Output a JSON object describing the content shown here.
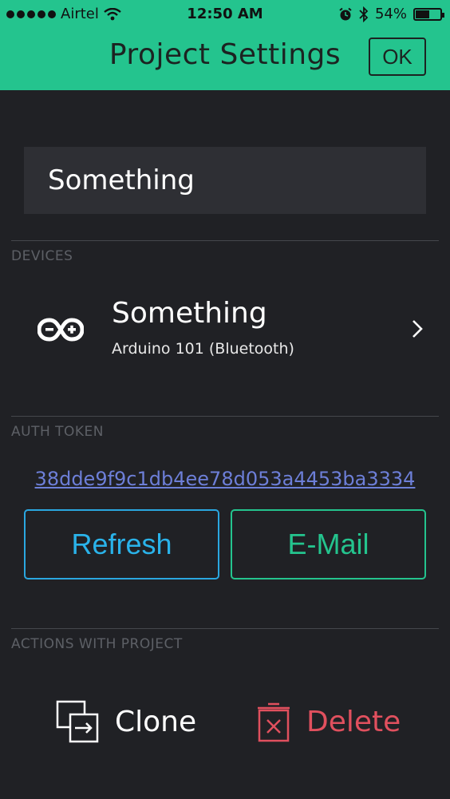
{
  "status_bar": {
    "carrier": "Airtel",
    "time": "12:50 AM",
    "battery_percent": "54%",
    "battery_level": 0.54
  },
  "header": {
    "title": "Project Settings",
    "ok_label": "OK"
  },
  "project": {
    "name": "Something"
  },
  "devices": {
    "section_label": "DEVICES",
    "items": [
      {
        "name": "Something",
        "type": "Arduino 101 (Bluetooth)",
        "icon": "arduino-icon"
      }
    ]
  },
  "auth": {
    "section_label": "AUTH TOKEN",
    "token": "38dde9f9c1db4ee78d053a4453ba3334",
    "refresh_label": "Refresh",
    "email_label": "E-Mail"
  },
  "actions": {
    "section_label": "ACTIONS WITH PROJECT",
    "clone_label": "Clone",
    "delete_label": "Delete"
  },
  "colors": {
    "header_bg": "#24c48e",
    "background": "#202125",
    "refresh": "#2ab3ea",
    "email": "#24c48e",
    "delete": "#e0505e",
    "token_link": "#6d7fd8"
  }
}
